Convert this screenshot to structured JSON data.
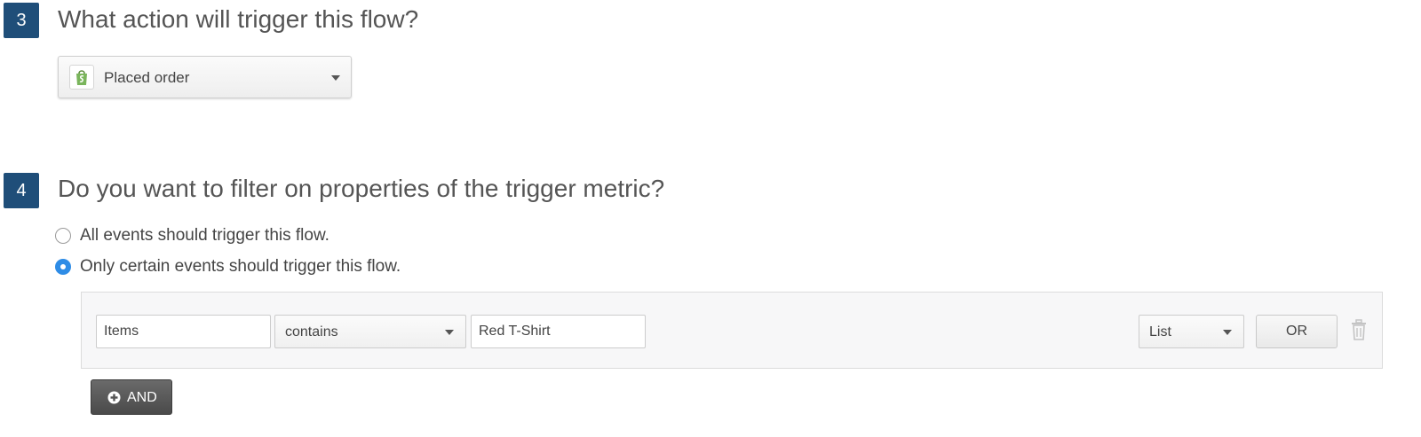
{
  "step3": {
    "number": "3",
    "title": "What action will trigger this flow?",
    "trigger": {
      "icon": "shopify-bag-icon",
      "selected": "Placed order"
    }
  },
  "step4": {
    "number": "4",
    "title": "Do you want to filter on properties of the trigger metric?",
    "options": [
      {
        "label": "All events should trigger this flow.",
        "checked": false
      },
      {
        "label": "Only certain events should trigger this flow.",
        "checked": true
      }
    ],
    "filter": {
      "property": "Items",
      "operator": "contains",
      "value": "Red T-Shirt",
      "type": "List",
      "or_label": "OR"
    },
    "and_label": "AND"
  },
  "colors": {
    "badge": "#1f4e79",
    "radio_accent": "#2e8ce6",
    "and_button": "#555555"
  }
}
